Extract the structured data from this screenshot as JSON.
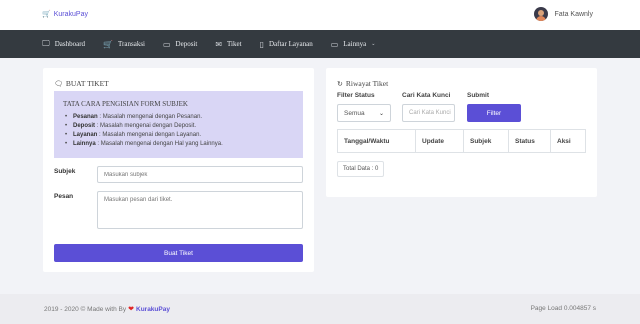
{
  "brand": {
    "name": "KurakuPay",
    "icon": "cart-icon"
  },
  "user": {
    "name": "Fata Kawnly"
  },
  "nav": [
    {
      "label": "Dashboard",
      "icon": "monitor-icon",
      "glyph": "🖵"
    },
    {
      "label": "Transaksi",
      "icon": "cart-icon",
      "glyph": "🛒"
    },
    {
      "label": "Deposit",
      "icon": "card-icon",
      "glyph": "▭"
    },
    {
      "label": "Tiket",
      "icon": "mail-icon",
      "glyph": "✉"
    },
    {
      "label": "Daftar Layanan",
      "icon": "clipboard-icon",
      "glyph": "▯"
    },
    {
      "label": "Lainnya",
      "icon": "folder-icon",
      "glyph": "▭"
    }
  ],
  "buat_tiket": {
    "title": "BUAT TIKET",
    "notice_title": "TATA CARA PENGISIAN FORM SUBJEK",
    "rules": [
      {
        "key": "Pesanan",
        "text": " : Masalah mengenai dengan Pesanan."
      },
      {
        "key": "Deposit",
        "text": " : Masalah mengenai dengan Deposit."
      },
      {
        "key": "Layanan",
        "text": " : Masalah mengenai dengan Layanan."
      },
      {
        "key": "Lainnya",
        "text": " : Masalah mengenai dengan Hal yang Lainnya."
      }
    ],
    "subjek_label": "Subjek",
    "subjek_placeholder": "Masukan subjek",
    "pesan_label": "Pesan",
    "pesan_placeholder": "Masukan pesan dari tiket.",
    "submit_label": "Buat Tiket"
  },
  "riwayat": {
    "title": "Riwayat Tiket",
    "filter_status_label": "Filter Status",
    "filter_status_value": "Semua",
    "kata_kunci_label": "Cari Kata Kunci",
    "kata_kunci_placeholder": "Cari Kata Kunci",
    "submit_label": "Submit",
    "filter_button": "Filter",
    "columns": [
      "Tanggal/Waktu",
      "Update",
      "Subjek",
      "Status",
      "Aksi"
    ],
    "total_label": "Total Data : 0"
  },
  "footer": {
    "copyright": "2019 - 2020 © Made with By",
    "brand": "KurakuPay",
    "page_load": "Page Load 0.004857 s"
  },
  "colors": {
    "accent": "#5b4fd6",
    "navbar": "#343a40",
    "notice_bg": "#d9d6f5"
  }
}
